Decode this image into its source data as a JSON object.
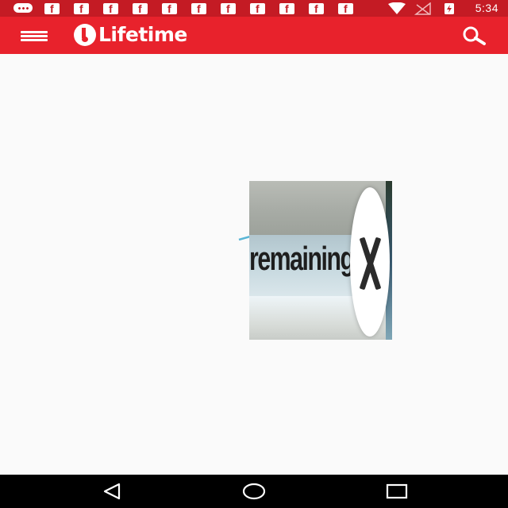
{
  "status_bar": {
    "time": "5:34",
    "notification_icons": [
      "message-icon",
      "facebook-icon",
      "facebook-icon",
      "facebook-icon",
      "facebook-icon",
      "facebook-icon",
      "facebook-icon",
      "facebook-icon",
      "facebook-icon",
      "facebook-icon",
      "facebook-icon",
      "facebook-icon"
    ],
    "system_icons": [
      "wifi-icon",
      "no-signal-icon",
      "battery-charging-icon"
    ]
  },
  "app_bar": {
    "logo_text": "Lifetime",
    "menu_icon": "menu-icon",
    "search_icon": "search-icon"
  },
  "ad_overlay": {
    "remaining_label": "remaining",
    "close_icon": "close-icon"
  },
  "nav_bar": {
    "icons": [
      "back-icon",
      "home-icon",
      "recents-icon"
    ]
  },
  "colors": {
    "status_bar": "#c41b24",
    "app_bar": "#e8222c",
    "background": "#fafafa",
    "nav_bar": "#000000"
  }
}
